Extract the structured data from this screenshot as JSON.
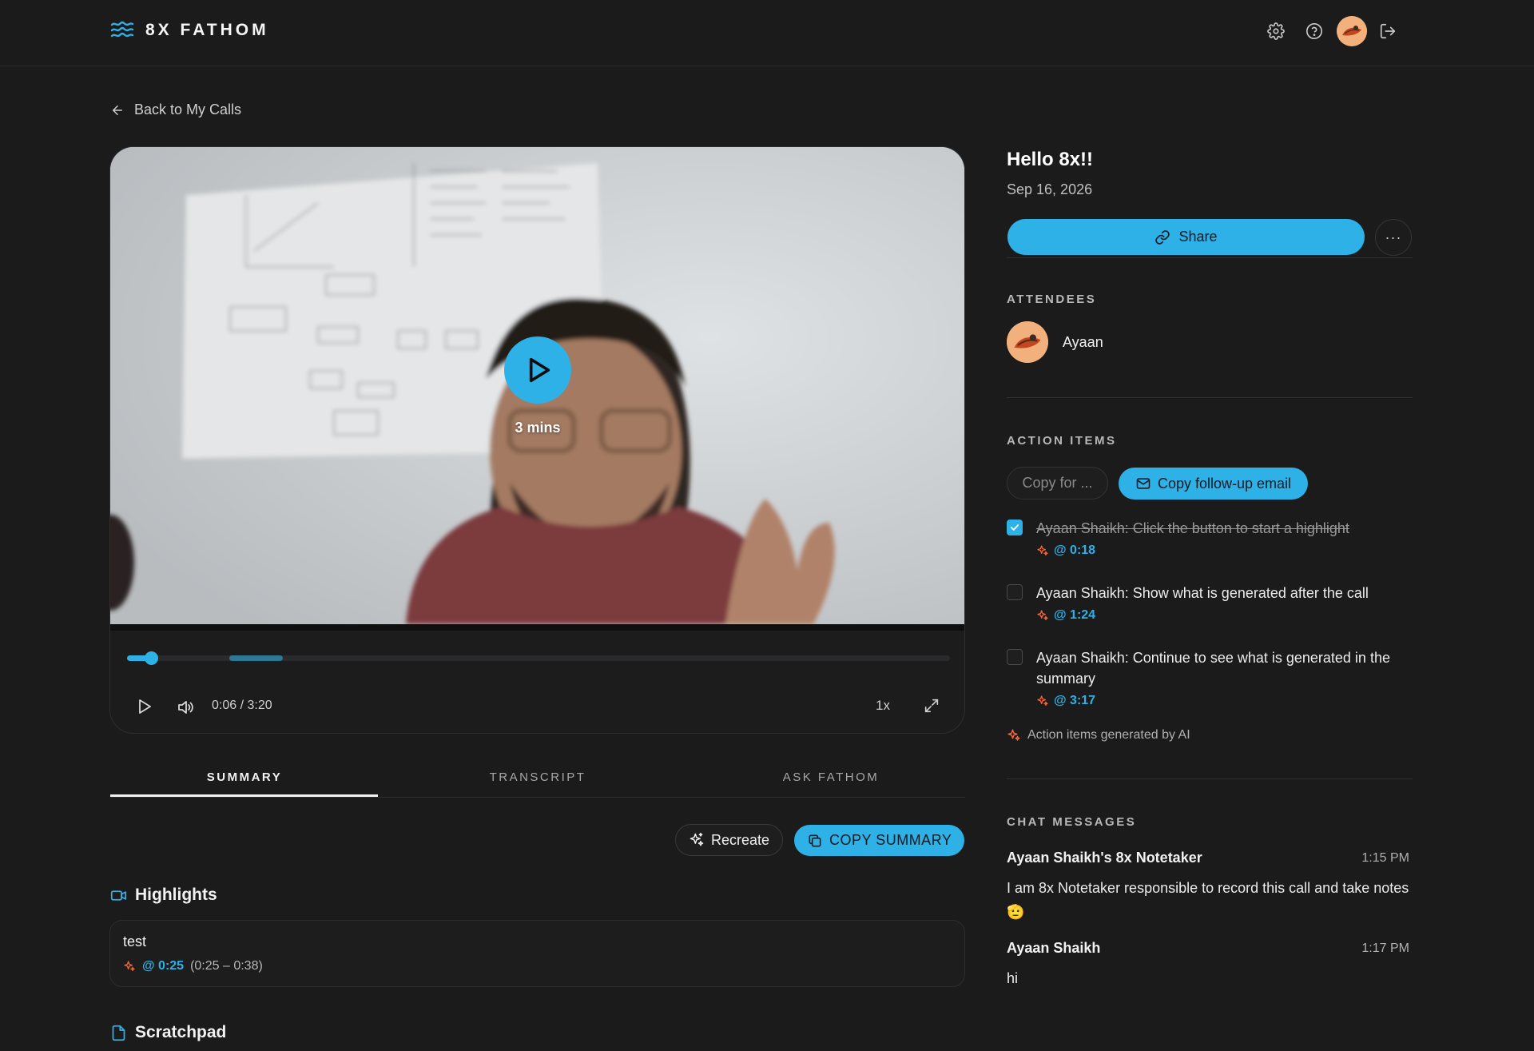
{
  "header": {
    "brand": "8X FATHOM",
    "icons": [
      "settings-icon",
      "help-icon",
      "avatar",
      "logout-icon"
    ]
  },
  "nav": {
    "back_label": "Back to My Calls"
  },
  "video": {
    "duration_label": "3 mins",
    "time": "0:06 / 3:20",
    "speed": "1x",
    "progress_seconds": 6,
    "total_seconds": 200
  },
  "tabs": [
    {
      "label": "SUMMARY",
      "active": true
    },
    {
      "label": "TRANSCRIPT",
      "active": false
    },
    {
      "label": "ASK FATHOM",
      "active": false
    }
  ],
  "summary_actions": {
    "recreate": "Recreate",
    "copy_summary": "COPY SUMMARY"
  },
  "highlights": {
    "title": "Highlights",
    "items": [
      {
        "name": "test",
        "timestamp": "@ 0:25",
        "range": "(0:25 – 0:38)"
      }
    ]
  },
  "scratchpad": {
    "title": "Scratchpad"
  },
  "call": {
    "title": "Hello 8x!!",
    "date": "Sep 16, 2026",
    "share_label": "Share",
    "more_label": "···"
  },
  "attendees": {
    "label": "ATTENDEES",
    "items": [
      {
        "name": "Ayaan"
      }
    ]
  },
  "action_items": {
    "label": "ACTION ITEMS",
    "copy_for": "Copy for ...",
    "copy_email": "Copy follow-up email",
    "items": [
      {
        "text": "Ayaan Shaikh: Click the button to start a highlight",
        "timestamp": "@ 0:18",
        "done": true
      },
      {
        "text": "Ayaan Shaikh: Show what is generated after the call",
        "timestamp": "@ 1:24",
        "done": false
      },
      {
        "text": "Ayaan Shaikh: Continue to see what is generated in the summary",
        "timestamp": "@ 3:17",
        "done": false
      }
    ],
    "note": "Action items generated by AI"
  },
  "chat": {
    "label": "CHAT MESSAGES",
    "messages": [
      {
        "author": "Ayaan Shaikh's 8x Notetaker",
        "time": "1:15 PM",
        "text": "I am 8x Notetaker responsible to record this call and take notes 🫡"
      },
      {
        "author": "Ayaan Shaikh",
        "time": "1:17 PM",
        "text": "hi"
      }
    ]
  },
  "colors": {
    "accent": "#2eb1e6",
    "background": "#1b1b1c",
    "ai_spark": "#f0663a"
  }
}
